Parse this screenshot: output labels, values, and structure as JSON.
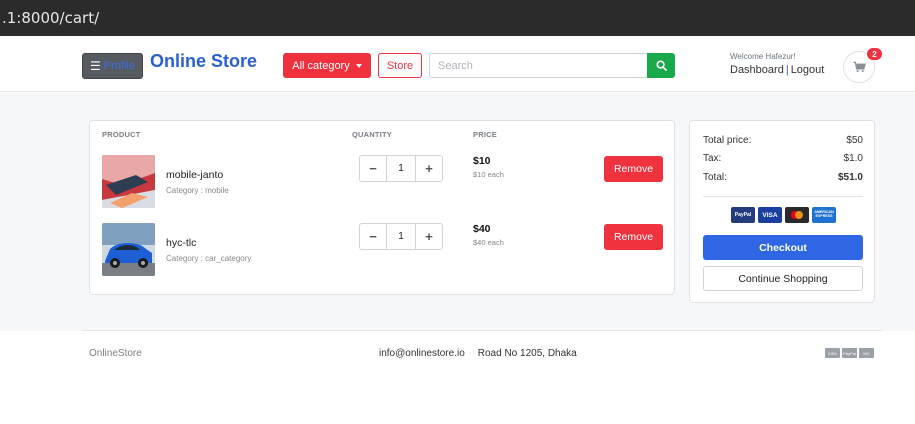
{
  "browser": {
    "url": ".1:8000/cart/"
  },
  "header": {
    "profile_label": "Profile",
    "brand": "Online Store",
    "category_label": "All category",
    "store_label": "Store",
    "search_placeholder": "Search",
    "welcome": "Welcome Hafezur!",
    "dashboard_link": "Dashboard",
    "separator": "|",
    "logout_link": "Logout",
    "cart_count": "2"
  },
  "cart": {
    "columns": {
      "product": "PRODUCT",
      "quantity": "QUANTITY",
      "price": "PRICE"
    },
    "items": [
      {
        "name": "mobile-janto",
        "category": "Category : mobile",
        "quantity": "1",
        "price": "$10",
        "each": "$10 each",
        "remove_label": "Remove"
      },
      {
        "name": "hyc-tlc",
        "category": "Category : car_category",
        "quantity": "1",
        "price": "$40",
        "each": "$40 each",
        "remove_label": "Remove"
      }
    ]
  },
  "summary": {
    "total_price_label": "Total price:",
    "total_price_value": "$50",
    "tax_label": "Tax:",
    "tax_value": "$1.0",
    "total_label": "Total:",
    "total_value": "$51.0",
    "payment_cards": [
      "PayPal",
      "VISA",
      "mastercard",
      "AMERICAN EXPRESS"
    ],
    "checkout_label": "Checkout",
    "continue_label": "Continue Shopping"
  },
  "footer": {
    "brand": "OnlineStore",
    "email": "info@onlinestore.io",
    "address": "Road No 1205, Dhaka",
    "cards": [
      "VISA",
      "PayPal",
      "MC"
    ]
  },
  "colors": {
    "brand_blue": "#2a5fcf",
    "danger_red": "#f0323f",
    "success_green": "#19a84a",
    "checkout_blue": "#2f66e4"
  }
}
